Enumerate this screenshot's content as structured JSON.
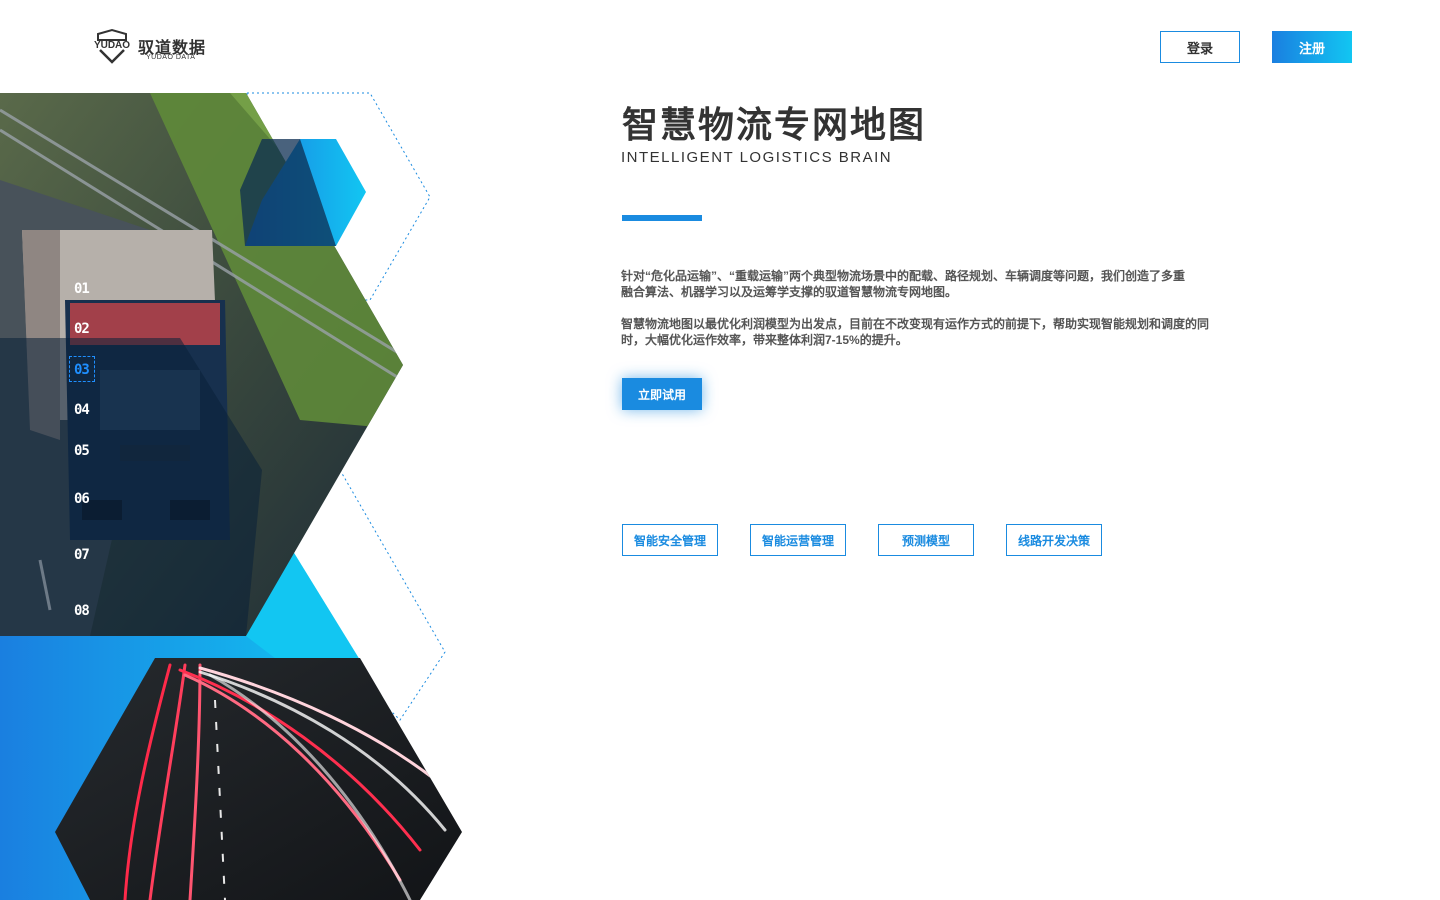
{
  "brand": {
    "name": "驭道数据",
    "sub": "YUDAO DATA",
    "mark": "YUDAO",
    "icon": "shield-logo-icon"
  },
  "header": {
    "login_label": "登录",
    "register_label": "注册"
  },
  "hero": {
    "title": "智慧物流专网地图",
    "subtitle": "INTELLIGENT LOGISTICS BRAIN",
    "para1_line1": "针对“危化品运输”、“重载运输”两个典型物流场景中的配载、路径规划、车辆调度等问题，我们创造了多重",
    "para1_line2": "融合算法、机器学习以及运筹学支撑的驭道智慧物流专网地图。",
    "para2_line1": "智慧物流地图以最优化利润模型为出发点，目前在不改变现有运作方式的前提下，帮助实现智能规划和调度的同",
    "para2_line2": "时，大幅优化运作效率，带来整体利润7-15%的提升。",
    "cta_label": "立即试用"
  },
  "tags": [
    "智能安全管理",
    "智能运营管理",
    "预测模型",
    "线路开发决策"
  ],
  "side_nav": {
    "items": [
      "01",
      "02",
      "03",
      "04",
      "05",
      "06",
      "07",
      "08"
    ],
    "active_index": 2
  },
  "colors": {
    "accent": "#1a8be0",
    "cyan": "#12c6f2",
    "navy": "#0d2a4a",
    "text": "#333333"
  }
}
